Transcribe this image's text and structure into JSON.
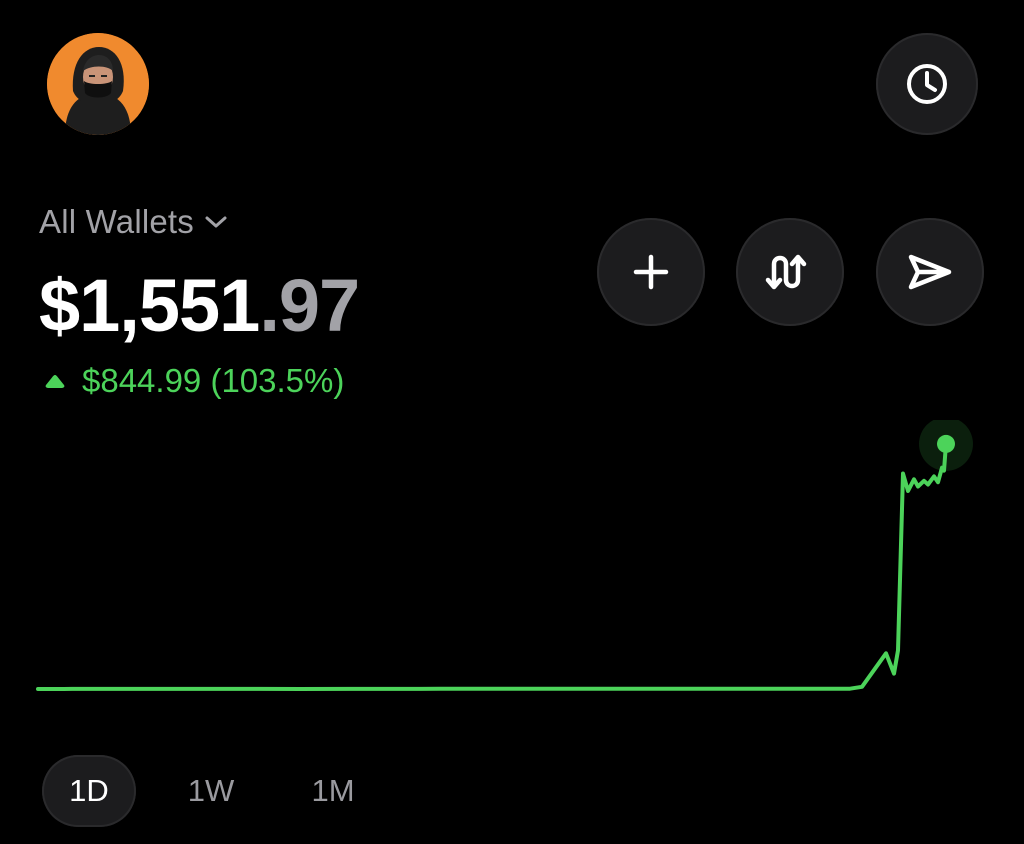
{
  "header": {
    "avatar_icon": "hooded-figure-avatar",
    "history_icon": "clock-icon"
  },
  "wallet": {
    "selector_label": "All Wallets",
    "balance_main": "$1,551",
    "balance_cents": ".97",
    "change_text": "$844.99 (103.5%)",
    "change_direction": "up"
  },
  "actions": [
    {
      "name": "add",
      "icon": "plus-icon"
    },
    {
      "name": "swap",
      "icon": "swap-arrows-icon"
    },
    {
      "name": "send",
      "icon": "send-icon"
    }
  ],
  "colors": {
    "background": "#000000",
    "positive": "#4cd35a",
    "muted_text": "#a2a2a7",
    "button_bg": "#1c1c1e",
    "avatar_bg": "#f08a2e"
  },
  "chart_data": {
    "type": "line",
    "series": [
      {
        "values": [
          707.0,
          707.0,
          707.2,
          707.4,
          707.1,
          707.3,
          707.2,
          707.0,
          707.2,
          707.3,
          707.4,
          707.5,
          707.6,
          707.5,
          707.7,
          707.8,
          707.9,
          708.0,
          708.0,
          708.1,
          707.9,
          708.0,
          714.5,
          830.0,
          760.0,
          840.0,
          1450.0,
          1390.0,
          1430.0,
          1405.0,
          1425.0,
          1412.0,
          1440.0,
          1420.0,
          1470.0,
          1460.0,
          1551.97
        ]
      }
    ],
    "ylim": [
      600,
      1600
    ],
    "grid": false,
    "legend": "none",
    "selected_range": "1D"
  },
  "range_tabs": [
    {
      "label": "1D",
      "active": true
    },
    {
      "label": "1W",
      "active": false
    },
    {
      "label": "1M",
      "active": false
    }
  ]
}
